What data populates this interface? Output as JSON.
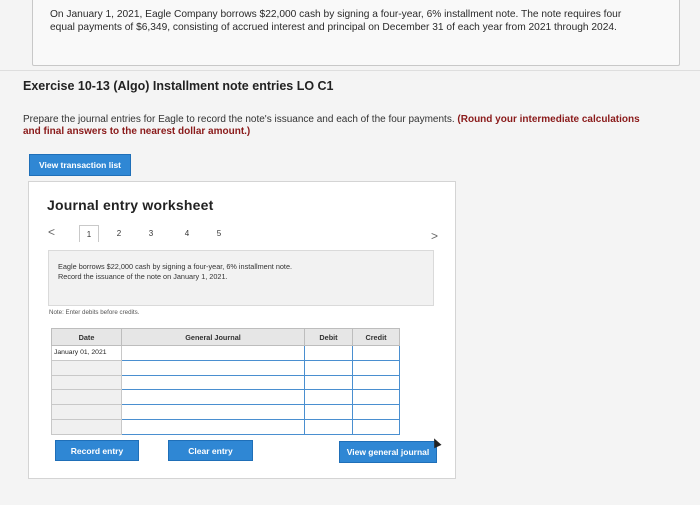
{
  "problem": {
    "text": "On January 1, 2021, Eagle Company borrows $22,000 cash by signing a four-year, 6% installment note. The note requires four equal payments of $6,349, consisting of accrued interest and principal on December 31 of each year from 2021 through 2024."
  },
  "exercise": {
    "title": "Exercise 10-13 (Algo) Installment note entries LO C1",
    "instruction": "Prepare the journal entries for Eagle to record the note's issuance and each of the four payments.",
    "instruction_bold": "(Round your intermediate calculations and final answers to the nearest dollar amount.)"
  },
  "buttons": {
    "view_transaction_list": "View transaction list",
    "record_entry": "Record entry",
    "clear_entry": "Clear entry",
    "view_general_journal": "View general journal"
  },
  "worksheet": {
    "title": "Journal entry worksheet",
    "prev_arrow": "<",
    "next_arrow": ">",
    "tabs": [
      "1",
      "2",
      "3",
      "4",
      "5"
    ],
    "active_tab": "1",
    "entry_line1": "Eagle borrows $22,000 cash by signing a four-year, 6% installment note.",
    "entry_line2": "Record the issuance of the note on January 1, 2021.",
    "note": "Note: Enter debits before credits."
  },
  "table": {
    "headers": {
      "date": "Date",
      "general_journal": "General Journal",
      "debit": "Debit",
      "credit": "Credit"
    },
    "first_date": "January 01, 2021",
    "row_count": 6
  },
  "colors": {
    "button_blue": "#2f87d4",
    "field_border_blue": "#4a8fd0"
  }
}
